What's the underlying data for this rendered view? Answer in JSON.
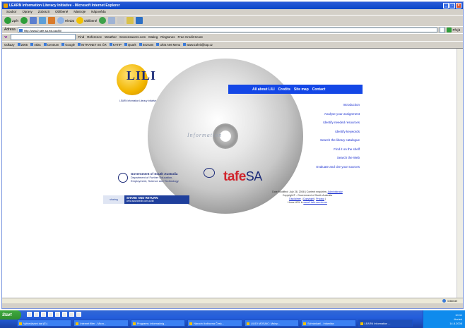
{
  "window": {
    "title": "LEARN Information Literacy Initiative - Microsoft Internet Explorer",
    "controls": [
      "_",
      "▫",
      "×"
    ]
  },
  "menu": [
    "Soubor",
    "Úpravy",
    "Zobrazit",
    "Oblíbené",
    "Nástroje",
    "Nápověda"
  ],
  "toolbar": {
    "back": "Zpět",
    "search": "Hledat",
    "favorites": "Oblíbené"
  },
  "address": {
    "label": "Adresa",
    "url": "http://www2.tafe.sa.edu.au/lili/",
    "go": "Přejít"
  },
  "yahoo_bar": {
    "find": "Find",
    "items": [
      "Reference",
      "Weather",
      "Screensavers.com",
      "Dating",
      "Ringtones",
      "Free Credit Score"
    ]
  },
  "links_bar": {
    "label": "Odkazy",
    "items": [
      "2005",
      "Atlas",
      "Centrum",
      "Google",
      "INTRANET SK ČR",
      "KATIP",
      "Quark",
      "Seznam",
      "Ultra Net Menu",
      "www.zahrit@top.cz"
    ]
  },
  "page": {
    "logo_letters": "LILI",
    "logo_tagline": "LEARN Information Literacy Initiative",
    "disc_word": "Information",
    "nav": [
      "All about LILI",
      "Credits",
      "Site map",
      "Contact"
    ],
    "links": [
      "Introduction",
      "Analyse your assignment",
      "Identify needed resources",
      "Identify keywords",
      "Search the library catalogue",
      "Find it on the shelf",
      "Search the Web",
      "Evaluate and cite your sources"
    ],
    "gov_title": "Government of South Australia",
    "gov_sub1": "Department of Further Education,",
    "gov_sub2": "Employment, Science and Technology",
    "tafe_main": "tafe",
    "tafe_suffix": "SA",
    "footer_line1_prefix": "Date Modified: July 28, 2008 | Content enquiries:",
    "footer_line1_link": "Administrator",
    "footer_line2": "Copyright© - Government of South Australia",
    "footer_line3_a": "Disclaimer",
    "footer_line3_b": "Copyright",
    "footer_line3_c": "Privacy",
    "footer_line4_prefix": "Home URL is",
    "footer_line4_link": "www2.tafe.sa.edu.au",
    "share_left": "sharing",
    "share_title": "SHARE AND RETURN",
    "share_url": "www.sasharedir.com.au/lili"
  },
  "status": {
    "zone": "Internet"
  },
  "taskbar": {
    "start": "Start",
    "tasks": [
      "Vyhledávání dat (E:)",
      "Internet filter - Micro...",
      "Programs: informačníg...",
      "Národní knihovna Česk...",
      "LILIDI MOSAIC: Mainp...",
      "Schránkahl - Infamilax",
      "LEARN Information ..."
    ],
    "clock_time": "10:11",
    "clock_day": "čtvrtek",
    "clock_date": "14.8.2008"
  }
}
